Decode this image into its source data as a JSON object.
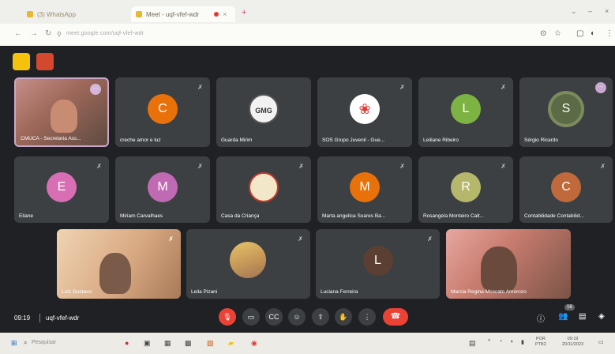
{
  "browser": {
    "tabs": [
      {
        "label": "(3) WhatsApp"
      },
      {
        "label": "Meet - uqf-vfef-wdr"
      }
    ],
    "new_tab": "+",
    "url": "meet.google.com/uqf-vfef-wdr",
    "window_controls": [
      "⌄",
      "–",
      "×"
    ]
  },
  "meeting": {
    "row1": [
      {
        "name": "CMUCA - Secretaria Ass...",
        "type": "camera"
      },
      {
        "name": "creche amor e luz",
        "type": "avatar",
        "initial": "C",
        "color": "#e8710a"
      },
      {
        "name": "Guarda Mirim",
        "type": "logo",
        "logo_text": "GMG"
      },
      {
        "name": "SOS Grupo Juvenil - Gue...",
        "type": "logo"
      },
      {
        "name": "Leiliane Ribeiro",
        "type": "avatar",
        "initial": "L",
        "color": "#7cb342"
      },
      {
        "name": "Sérgio Ricardo",
        "type": "avatar",
        "initial": "S",
        "color": "#5a6b45"
      }
    ],
    "row2": [
      {
        "name": "Eliane",
        "type": "avatar",
        "initial": "E",
        "color": "#d86fb5"
      },
      {
        "name": "Miriam Carvalhaes",
        "type": "avatar",
        "initial": "M",
        "color": "#c06ab3"
      },
      {
        "name": "Casa da Criança",
        "type": "logo"
      },
      {
        "name": "Marta angelica Soares Ba...",
        "type": "avatar",
        "initial": "M",
        "color": "#e8710a"
      },
      {
        "name": "Rosangela Monteiro Calt...",
        "type": "avatar",
        "initial": "R",
        "color": "#b5b86a"
      },
      {
        "name": "Contabilidade Contabilid...",
        "type": "avatar",
        "initial": "C",
        "color": "#c0693a"
      }
    ],
    "row3": [
      {
        "name": "Luiz Gustavo",
        "type": "camera"
      },
      {
        "name": "Leila Pizani",
        "type": "camera"
      },
      {
        "name": "Luciana Ferreira",
        "type": "avatar",
        "initial": "L",
        "color": "#5b3f33"
      },
      {
        "name": "Marcia Regina Moscato Amorozo",
        "type": "camera"
      }
    ]
  },
  "controls": {
    "time": "09:19",
    "meeting_code": "uqf-vfef-wdr",
    "participant_count": "16"
  },
  "taskbar": {
    "search_placeholder": "Pesquisar",
    "lang": "POR",
    "lang2": "PTB2",
    "time": "09:19",
    "date": "20/11/2023"
  }
}
